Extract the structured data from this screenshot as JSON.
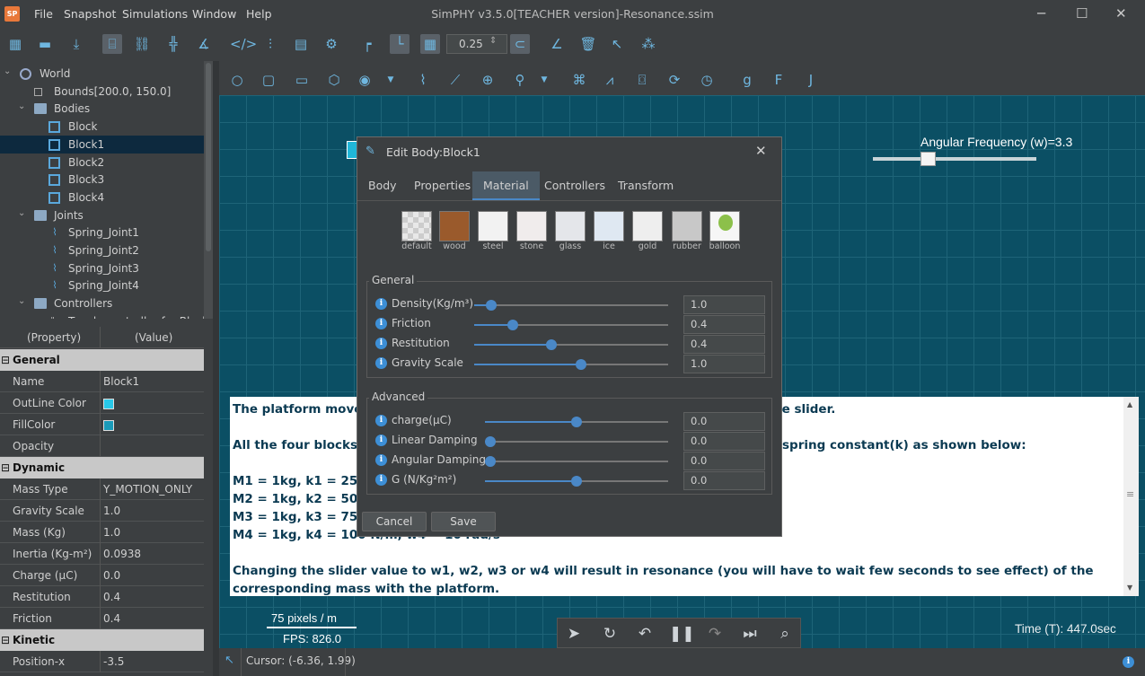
{
  "window": {
    "title": "SimPHY v3.5.0[TEACHER version]-Resonance.ssim",
    "logo": "SP",
    "menu": [
      "File",
      "Snapshot",
      "Simulations",
      "Window",
      "Help"
    ],
    "controls": {
      "minimize": "─",
      "maximize": "☐",
      "close": "✕"
    }
  },
  "toolbar": {
    "zoom_value": "0.25"
  },
  "tree": {
    "items": [
      {
        "label": "World",
        "level": 0,
        "icon": "world-icon"
      },
      {
        "label": "Bounds[200.0, 150.0]",
        "level": 1,
        "icon": "bounds-icon"
      },
      {
        "label": "Bodies",
        "level": 1,
        "icon": "folder-icon"
      },
      {
        "label": "Block",
        "level": 2,
        "icon": "body-icon"
      },
      {
        "label": "Block1",
        "level": 2,
        "icon": "body-icon",
        "selected": true
      },
      {
        "label": "Block2",
        "level": 2,
        "icon": "body-icon"
      },
      {
        "label": "Block3",
        "level": 2,
        "icon": "body-icon"
      },
      {
        "label": "Block4",
        "level": 2,
        "icon": "body-icon"
      },
      {
        "label": "Joints",
        "level": 1,
        "icon": "folder-icon"
      },
      {
        "label": "Spring_Joint1",
        "level": 2,
        "icon": "spring-icon"
      },
      {
        "label": "Spring_Joint2",
        "level": 2,
        "icon": "spring-icon"
      },
      {
        "label": "Spring_Joint3",
        "level": 2,
        "icon": "spring-icon"
      },
      {
        "label": "Spring_Joint4",
        "level": 2,
        "icon": "spring-icon"
      },
      {
        "label": "Controllers",
        "level": 1,
        "icon": "folder-icon"
      },
      {
        "label": "Toggle controller for Block",
        "level": 2,
        "icon": "controller-icon"
      }
    ]
  },
  "props": {
    "header": {
      "property": "(Property)",
      "value": "(Value)"
    },
    "sections": [
      {
        "title": "General",
        "rows": [
          {
            "k": "Name",
            "v": "Block1"
          },
          {
            "k": "OutLine Color",
            "v": "",
            "swatch": "#28c8e8"
          },
          {
            "k": "FillColor",
            "v": "",
            "swatch": "#1a9ab8"
          },
          {
            "k": "Opacity",
            "v": ""
          }
        ]
      },
      {
        "title": "Dynamic",
        "rows": [
          {
            "k": "Mass Type",
            "v": "Y_MOTION_ONLY"
          },
          {
            "k": "Gravity Scale",
            "v": "1.0"
          },
          {
            "k": "Mass (Kg)",
            "v": "1.0"
          },
          {
            "k": "Inertia (Kg-m²)",
            "v": "0.0938"
          },
          {
            "k": "Charge (µC)",
            "v": "0.0"
          },
          {
            "k": "Restitution",
            "v": "0.4"
          },
          {
            "k": "Friction",
            "v": "0.4"
          }
        ]
      },
      {
        "title": "Kinetic",
        "rows": [
          {
            "k": "Position-x",
            "v": "-3.5"
          }
        ]
      }
    ]
  },
  "canvas": {
    "slider_label": "Angular Frequency (w)=3.3",
    "scale_label": "75 pixels / m",
    "fps": "FPS: 826.0",
    "time": "Time (T): 447.0sec"
  },
  "textpanel": {
    "line1a": "The platform moves",
    "line1b": "he slider.",
    "line2a": "All the four blocks h",
    "line2b": "spring constant(k) as shown below:",
    "m1": "M1 = 1kg, k1 = 25 N/",
    "m2": "M2 = 1kg, k2 = 50 N/",
    "m3": "M3 = 1kg, k3 = 75 N/",
    "m4": "M4 = 1kg, k4 = 100 N/m, w4 = 10 rad/s",
    "para": "Changing the slider value to w1, w2, w3 or w4 will result in resonance (you will have to wait few seconds to see effect) of the corresponding mass with the platform."
  },
  "dialog": {
    "title": "Edit Body:Block1",
    "tabs": [
      "Body",
      "Properties",
      "Material",
      "Controllers",
      "Transform"
    ],
    "active_tab": "Material",
    "materials": [
      {
        "name": "default",
        "color": "#e8e8e8"
      },
      {
        "name": "wood",
        "color": "#9a5a2c"
      },
      {
        "name": "steel",
        "color": "#f2f2f2"
      },
      {
        "name": "stone",
        "color": "#f0ecec"
      },
      {
        "name": "glass",
        "color": "#e4e6ea"
      },
      {
        "name": "ice",
        "color": "#dfe8f2"
      },
      {
        "name": "gold",
        "color": "#eeeeee"
      },
      {
        "name": "rubber",
        "color": "#c8c8c8"
      },
      {
        "name": "balloon",
        "color": "#f6f6f6"
      }
    ],
    "general": {
      "label": "General",
      "fields": [
        {
          "label": "Density(Kg/m³)",
          "value": "1.0",
          "fraction": 0.09
        },
        {
          "label": "Friction",
          "value": "0.4",
          "fraction": 0.2
        },
        {
          "label": "Restitution",
          "value": "0.4",
          "fraction": 0.4
        },
        {
          "label": "Gravity Scale",
          "value": "1.0",
          "fraction": 0.55
        }
      ]
    },
    "advanced": {
      "label": "Advanced",
      "fields": [
        {
          "label": "charge(µC)",
          "value": "0.0",
          "fraction": 0.5
        },
        {
          "label": "Linear Damping",
          "value": "0.0",
          "fraction": 0.0
        },
        {
          "label": "Angular Damping",
          "value": "0.0",
          "fraction": 0.0
        },
        {
          "label": "G (N/Kg²m²)",
          "value": "0.0",
          "fraction": 0.5
        }
      ]
    },
    "cancel": "Cancel",
    "save": "Save",
    "close": "✕"
  },
  "status": {
    "cursor": "Cursor: (-6.36, 1.99)"
  }
}
